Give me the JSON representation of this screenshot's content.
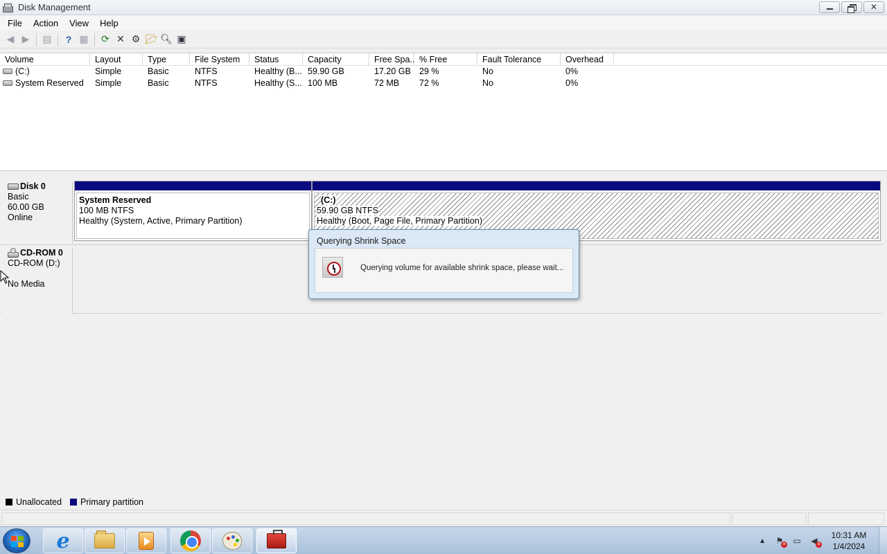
{
  "window": {
    "title": "Disk Management"
  },
  "menu": [
    "File",
    "Action",
    "View",
    "Help"
  ],
  "toolbar": {
    "buttons": [
      "back-icon",
      "forward-icon",
      "console-tree-icon",
      "help-icon",
      "properties-icon",
      "refresh-icon",
      "delete-icon",
      "settings-icon",
      "open-icon",
      "search-icon",
      "help-topics-icon"
    ]
  },
  "volume_table": {
    "columns": [
      "Volume",
      "Layout",
      "Type",
      "File System",
      "Status",
      "Capacity",
      "Free Spa...",
      "% Free",
      "Fault Tolerance",
      "Overhead"
    ],
    "rows": [
      [
        "(C:)",
        "Simple",
        "Basic",
        "NTFS",
        "Healthy (B...",
        "59.90 GB",
        "17.20 GB",
        "29 %",
        "No",
        "0%"
      ],
      [
        "System Reserved",
        "Simple",
        "Basic",
        "NTFS",
        "Healthy (S...",
        "100 MB",
        "72 MB",
        "72 %",
        "No",
        "0%"
      ]
    ]
  },
  "disks": [
    {
      "name": "Disk 0",
      "lines": [
        "Basic",
        "60.00 GB",
        "Online"
      ],
      "partitions": [
        {
          "name": "System Reserved",
          "size": "100 MB NTFS",
          "status": "Healthy (System, Active, Primary Partition)"
        },
        {
          "name": "(C:)",
          "size": "59.90 GB NTFS",
          "status": "Healthy (Boot, Page File, Primary Partition)"
        }
      ]
    },
    {
      "name": "CD-ROM 0",
      "lines": [
        "CD-ROM (D:)",
        "",
        "No Media"
      ]
    }
  ],
  "legend": [
    {
      "label": "Unallocated",
      "color": "#000000"
    },
    {
      "label": "Primary partition",
      "color": "#0a0a80"
    }
  ],
  "dialog": {
    "title": "Querying Shrink Space",
    "message": "Querying volume for available shrink space, please wait..."
  },
  "taskbar": {
    "apps": [
      "internet-explorer-icon",
      "file-explorer-icon",
      "media-player-icon",
      "chrome-icon",
      "paint-icon",
      "computer-management-icon"
    ],
    "clock": {
      "time": "10:31 AM",
      "date": "1/4/2024"
    }
  }
}
